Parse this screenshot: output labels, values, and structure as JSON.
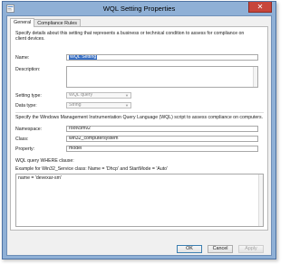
{
  "window": {
    "title": "WQL Setting Properties",
    "close_glyph": "✕"
  },
  "tabs": [
    {
      "label": "General",
      "active": true
    },
    {
      "label": "Compliance Rules",
      "active": false
    }
  ],
  "general": {
    "intro": "Specify details about this setting that represents a business or technical condition to assess for compliance on client devices.",
    "name_label": "Name:",
    "name_value": "WQL Setting",
    "description_label": "Description:",
    "description_value": "",
    "setting_type_label": "Setting type:",
    "setting_type_value": "WQL query",
    "data_type_label": "Data type:",
    "data_type_value": "String",
    "wql_intro": "Specify the Windows Management Instrumentation Query Language (WQL) script to assess compliance on computers.",
    "namespace_label": "Namespace:",
    "namespace_value": "root\\cimv2",
    "class_label": "Class:",
    "class_value": "win32_computersystem",
    "property_label": "Property:",
    "property_value": "model",
    "where_label": "WQL query WHERE clause:",
    "example_text": "Example for Win32_Service class: Name = 'Dhcp' and StartMode = 'Auto'",
    "where_value": "name = 'devexar-sm'"
  },
  "buttons": {
    "ok": "OK",
    "cancel": "Cancel",
    "apply": "Apply"
  },
  "colors": {
    "frame": "#8fb0d6",
    "close": "#c7463b",
    "selection": "#3a70c4"
  }
}
